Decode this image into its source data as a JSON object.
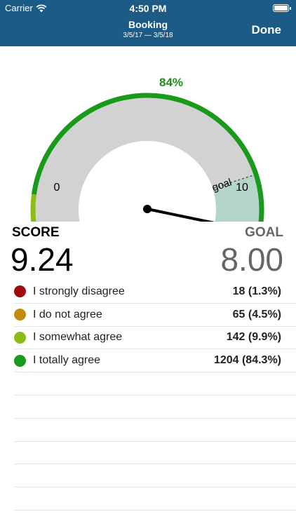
{
  "status_bar": {
    "carrier": "Carrier",
    "time": "4:50 PM",
    "wifi_icon": "wifi-icon",
    "battery_icon": "battery-icon"
  },
  "nav": {
    "title": "Booking",
    "subtitle": "3/5/17 — 3/5/18",
    "done_label": "Done",
    "background_color": "#1c5b86"
  },
  "gauge": {
    "percent_label": "84%",
    "min_label": "0",
    "max_label": "10",
    "goal_text": "goal",
    "score_value": 9.24,
    "goal_value": 8.0,
    "range_min": 0,
    "range_max": 10,
    "colors": {
      "track": "#d2d2d2",
      "goal_zone": "#b3d6c8",
      "needle": "#000000",
      "percent_text": "#1e8f1e"
    }
  },
  "summary": {
    "score_label": "SCORE",
    "score_value": "9.24",
    "goal_label": "GOAL",
    "goal_value": "8.00"
  },
  "responses": [
    {
      "label": "I strongly disagree",
      "value": "18 (1.3%)",
      "count": 18,
      "percent": 1.3,
      "color": "#9e0c0c"
    },
    {
      "label": "I do not agree",
      "value": "65 (4.5%)",
      "count": 65,
      "percent": 4.5,
      "color": "#c38b0d"
    },
    {
      "label": "I somewhat agree",
      "value": "142 (9.9%)",
      "count": 142,
      "percent": 9.9,
      "color": "#8dbb17"
    },
    {
      "label": "I totally agree",
      "value": "1204 (84.3%)",
      "count": 1204,
      "percent": 84.3,
      "color": "#1a9a1a"
    }
  ]
}
